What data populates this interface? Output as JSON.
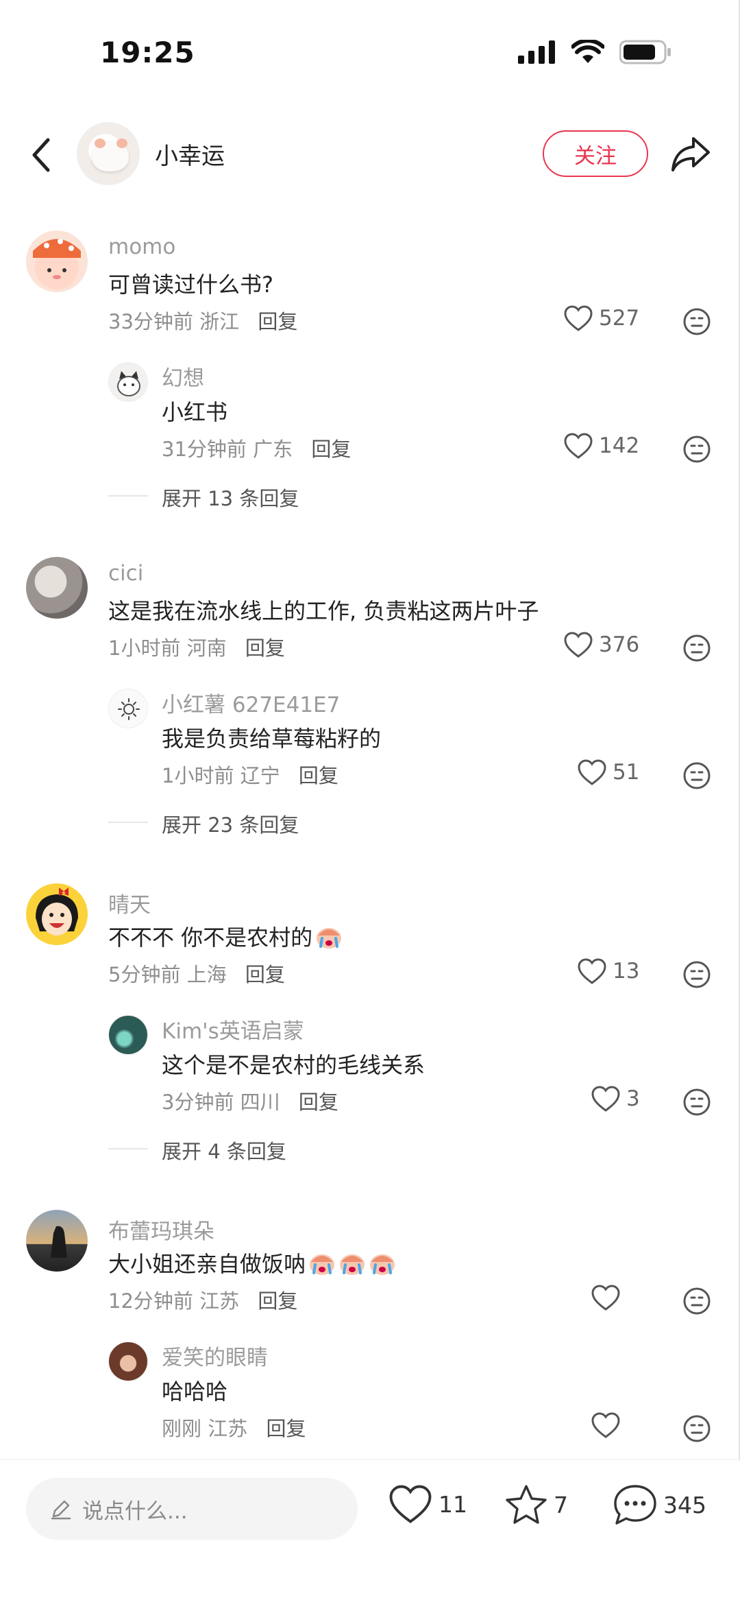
{
  "status_bar": {
    "time": "19:25"
  },
  "header": {
    "title": "小幸运",
    "follow_label": "关注"
  },
  "comments": [
    {
      "user": "momo",
      "text": "可曾读过什么书?",
      "time": "33分钟前",
      "location": "浙江",
      "reply_label": "回复",
      "likes": "527",
      "reply": {
        "user": "幻想",
        "text": "小红书",
        "time": "31分钟前",
        "location": "广东",
        "reply_label": "回复",
        "likes": "142"
      },
      "expand_label": "展开 13 条回复"
    },
    {
      "user": "cici",
      "text": "这是我在流水线上的工作, 负责粘这两片叶子",
      "time": "1小时前",
      "location": "河南",
      "reply_label": "回复",
      "likes": "376",
      "reply": {
        "user": "小红薯 627E41E7",
        "text": "我是负责给草莓粘籽的",
        "time": "1小时前",
        "location": "辽宁",
        "reply_label": "回复",
        "likes": "51"
      },
      "expand_label": "展开 23 条回复"
    },
    {
      "user": "晴天",
      "text": "不不不 你不是农村的",
      "time": "5分钟前",
      "location": "上海",
      "reply_label": "回复",
      "likes": "13",
      "reply": {
        "user": "Kim's英语启蒙",
        "text": "这个是不是农村的毛线关系",
        "time": "3分钟前",
        "location": "四川",
        "reply_label": "回复",
        "likes": "3"
      },
      "expand_label": "展开 4 条回复"
    },
    {
      "user": "布蕾玛琪朵",
      "text": "大小姐还亲自做饭呐",
      "time": "12分钟前",
      "location": "江苏",
      "reply_label": "回复",
      "likes": "",
      "reply": {
        "user": "爱笑的眼睛",
        "text": "哈哈哈",
        "time": "刚刚",
        "location": "江苏",
        "reply_label": "回复",
        "likes": ""
      }
    }
  ],
  "bottom_bar": {
    "input_placeholder": "说点什么...",
    "like_count": "11",
    "collect_count": "7",
    "comment_count": "345"
  },
  "colors": {
    "accent": "#e8364f",
    "muted_text": "#9b9b9b",
    "icon_gray": "#666666"
  }
}
